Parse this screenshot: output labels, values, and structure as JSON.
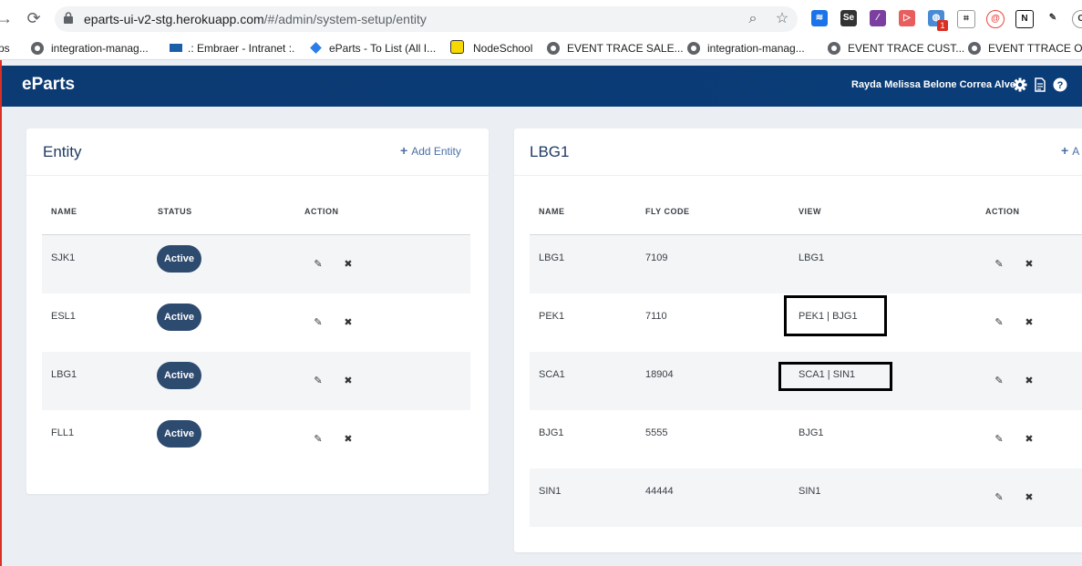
{
  "browser": {
    "url_host": "eparts-ui-v2-stg.herokuapp.com",
    "url_path": "/#/admin/system-setup/entity",
    "bookmarks": [
      {
        "label": "ps",
        "icon": "none"
      },
      {
        "label": "integration-manag...",
        "icon": "globe-icon"
      },
      {
        "label": ".: Embraer - Intranet :.",
        "icon": "sap-icon"
      },
      {
        "label": "eParts - To List (All I...",
        "icon": "diamond-icon"
      },
      {
        "label": "NodeSchool",
        "icon": "hexagon-icon"
      },
      {
        "label": "EVENT TRACE SALE...",
        "icon": "globe-icon"
      },
      {
        "label": "integration-manag...",
        "icon": "globe-icon"
      },
      {
        "label": "EVENT TRACE CUST...",
        "icon": "globe-icon"
      },
      {
        "label": "EVENT TTRACE Ord",
        "icon": "globe-icon"
      }
    ],
    "ext_badge": "1"
  },
  "app": {
    "brand": "eParts",
    "user_name": "Rayda Melissa Belone Correa Alves",
    "colors": {
      "topbar": "#0c3a72",
      "badge": "#2d4a6f",
      "accent": "#4a6fa5"
    }
  },
  "entity_card": {
    "title": "Entity",
    "add_label": "Add Entity",
    "headers": {
      "name": "NAME",
      "status": "STATUS",
      "action": "ACTION"
    },
    "rows": [
      {
        "name": "SJK1",
        "status": "Active"
      },
      {
        "name": "ESL1",
        "status": "Active"
      },
      {
        "name": "LBG1",
        "status": "Active"
      },
      {
        "name": "FLL1",
        "status": "Active"
      }
    ]
  },
  "detail_card": {
    "title": "LBG1",
    "add_label": "A",
    "headers": {
      "name": "NAME",
      "fly_code": "FLY CODE",
      "view": "VIEW",
      "action": "ACTION"
    },
    "rows": [
      {
        "name": "LBG1",
        "fly_code": "7109",
        "view": "LBG1"
      },
      {
        "name": "PEK1",
        "fly_code": "7110",
        "view": "PEK1 | BJG1"
      },
      {
        "name": "SCA1",
        "fly_code": "18904",
        "view": "SCA1 | SIN1"
      },
      {
        "name": "BJG1",
        "fly_code": "5555",
        "view": "BJG1"
      },
      {
        "name": "SIN1",
        "fly_code": "44444",
        "view": "SIN1"
      }
    ]
  }
}
